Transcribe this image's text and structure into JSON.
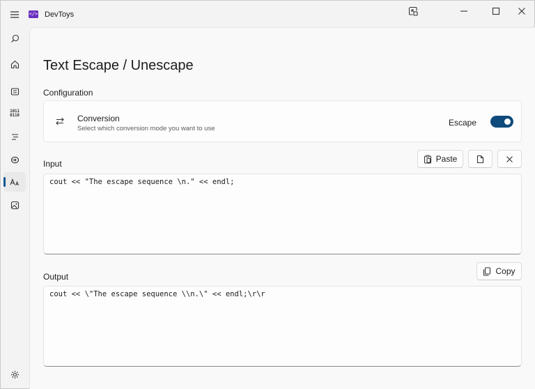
{
  "app": {
    "title": "DevToys",
    "logo_glyph": "</>",
    "accent_color": "#0e4a7b",
    "logo_color": "#6b2fbf"
  },
  "titlebar": {
    "buttons": [
      "compact-overlay-icon",
      "minimize-icon",
      "maximize-icon",
      "close-icon"
    ]
  },
  "sidebar": {
    "items": [
      {
        "icon": "search-icon"
      },
      {
        "icon": "home-icon"
      },
      {
        "icon": "converters-icon"
      },
      {
        "icon": "binary-icon",
        "glyph_top": "1011",
        "glyph_bottom": "0110"
      },
      {
        "icon": "formatters-icon"
      },
      {
        "icon": "graphic-icon"
      },
      {
        "icon": "text-icon",
        "selected": true
      },
      {
        "icon": "image-icon"
      }
    ],
    "settings_icon": "gear-icon"
  },
  "page": {
    "title": "Text Escape / Unescape"
  },
  "configuration": {
    "label": "Configuration",
    "conversion": {
      "title": "Conversion",
      "description": "Select which conversion mode you want to use",
      "toggle_label": "Escape",
      "toggle_on": true
    }
  },
  "input": {
    "label": "Input",
    "paste_label": "Paste",
    "value": "cout << \"The escape sequence \\n.\" << endl;"
  },
  "output": {
    "label": "Output",
    "copy_label": "Copy",
    "value": "cout << \\\"The escape sequence \\\\n.\\\" << endl;\\r\\r"
  }
}
